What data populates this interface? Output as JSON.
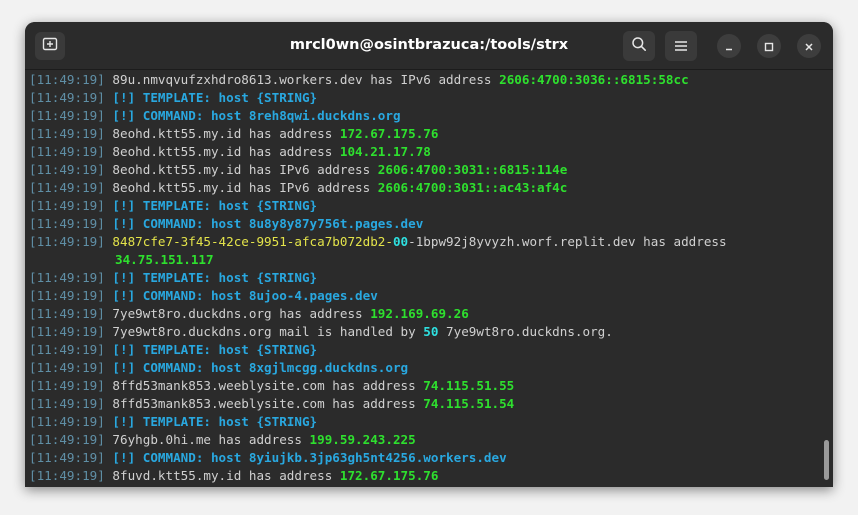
{
  "window": {
    "title": "mrcl0wn@osintbrazuca:/tools/strx"
  },
  "icons": {
    "new_tab": "new-tab-icon",
    "search": "search-icon",
    "menu": "hamburger-menu-icon",
    "minimize": "minimize-icon",
    "maximize": "maximize-icon",
    "close": "close-icon"
  },
  "colors": {
    "timestamp": "#5f8fa6",
    "template": "#29a8e0",
    "address": "#2ee02e",
    "priority": "#2ee0e0",
    "uuid": "#e3e34a",
    "background": "#2b2b2b"
  },
  "terminal": {
    "lines": [
      {
        "ts": "[11:49:19]",
        "pre": " 89u.nmvqvufzxhdro8613.workers.dev has IPv6 address ",
        "val": "2606:4700:3036::6815:58cc"
      },
      {
        "ts": "[11:49:19]",
        "tpl": " [!] TEMPLATE: host {STRING}"
      },
      {
        "ts": "[11:49:19]",
        "tpl": " [!] COMMAND: host 8reh8qwi.duckdns.org"
      },
      {
        "ts": "[11:49:19]",
        "pre": " 8eohd.ktt55.my.id has address ",
        "val": "172.67.175.76"
      },
      {
        "ts": "[11:49:19]",
        "pre": " 8eohd.ktt55.my.id has address ",
        "val": "104.21.17.78"
      },
      {
        "ts": "[11:49:19]",
        "pre": " 8eohd.ktt55.my.id has IPv6 address ",
        "val": "2606:4700:3031::6815:114e"
      },
      {
        "ts": "[11:49:19]",
        "pre": " 8eohd.ktt55.my.id has IPv6 address ",
        "val": "2606:4700:3031::ac43:af4c"
      },
      {
        "ts": "[11:49:19]",
        "tpl": " [!] TEMPLATE: host {STRING}"
      },
      {
        "ts": "[11:49:19]",
        "tpl": " [!] COMMAND: host 8u8y8y87y756t.pages.dev"
      },
      {
        "ts": "[11:49:19]",
        "uuid": " 8487cfe7-3f45-42ce-9951-afca7b072db2-",
        "uuid_mid": "00",
        "post": "-1bpw92j8yvyzh.worf.replit.dev has address"
      },
      {
        "ts": "",
        "wrapval": "34.75.151.117"
      },
      {
        "ts": "[11:49:19]",
        "tpl": " [!] TEMPLATE: host {STRING}"
      },
      {
        "ts": "[11:49:19]",
        "tpl": " [!] COMMAND: host 8ujoo-4.pages.dev"
      },
      {
        "ts": "[11:49:19]",
        "pre": " 7ye9wt8ro.duckdns.org has address ",
        "val": "192.169.69.26"
      },
      {
        "ts": "[11:49:19]",
        "pre": " 7ye9wt8ro.duckdns.org mail is handled by ",
        "prio": "50",
        "post": " 7ye9wt8ro.duckdns.org."
      },
      {
        "ts": "[11:49:19]",
        "tpl": " [!] TEMPLATE: host {STRING}"
      },
      {
        "ts": "[11:49:19]",
        "tpl": " [!] COMMAND: host 8xgjlmcgg.duckdns.org"
      },
      {
        "ts": "[11:49:19]",
        "pre": " 8ffd53mank853.weeblysite.com has address ",
        "val": "74.115.51.55"
      },
      {
        "ts": "[11:49:19]",
        "pre": " 8ffd53mank853.weeblysite.com has address ",
        "val": "74.115.51.54"
      },
      {
        "ts": "[11:49:19]",
        "tpl": " [!] TEMPLATE: host {STRING}"
      },
      {
        "ts": "[11:49:19]",
        "pre": " 76yhgb.0hi.me has address ",
        "val": "199.59.243.225"
      },
      {
        "ts": "[11:49:19]",
        "tpl": " [!] COMMAND: host 8yiujkb.3jp63gh5nt4256.workers.dev"
      },
      {
        "ts": "[11:49:19]",
        "pre": " 8fuvd.ktt55.my.id has address ",
        "val": "172.67.175.76"
      }
    ]
  }
}
